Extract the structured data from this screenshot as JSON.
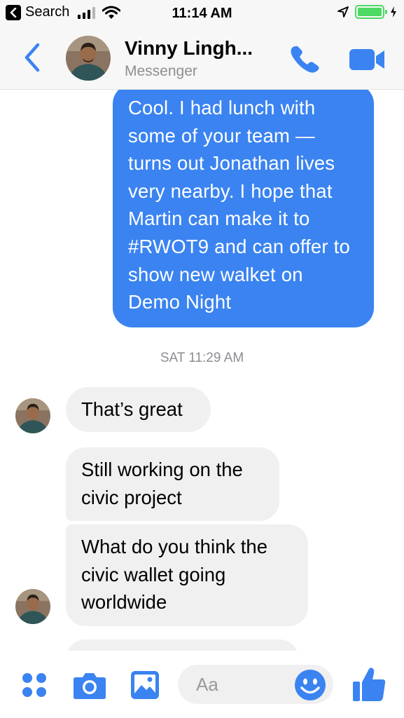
{
  "status_bar": {
    "back_label": "Search",
    "time": "11:14 AM"
  },
  "header": {
    "contact_name": "Vinny Lingh...",
    "subtitle": "Messenger"
  },
  "messages": {
    "outgoing_1": "Cool. I had lunch with some of your team — turns out Jonathan lives very nearby. I hope that Martin can make it to #RWOT9 and can offer to show new walket on Demo Night",
    "timestamp": "SAT 11:29 AM",
    "incoming_1": "That’s great",
    "incoming_2": "Still working on the civic project",
    "incoming_3": "What do you think the civic wallet going worldwide"
  },
  "composer": {
    "placeholder": "Aa"
  },
  "colors": {
    "accent": "#3a83f1",
    "incoming_bubble": "#f0f0f0",
    "battery": "#4cd964"
  },
  "icons": [
    "back-icon",
    "phone-icon",
    "video-icon",
    "more-icon",
    "camera-icon",
    "gallery-icon",
    "emoji-icon",
    "thumbs-up-icon"
  ]
}
